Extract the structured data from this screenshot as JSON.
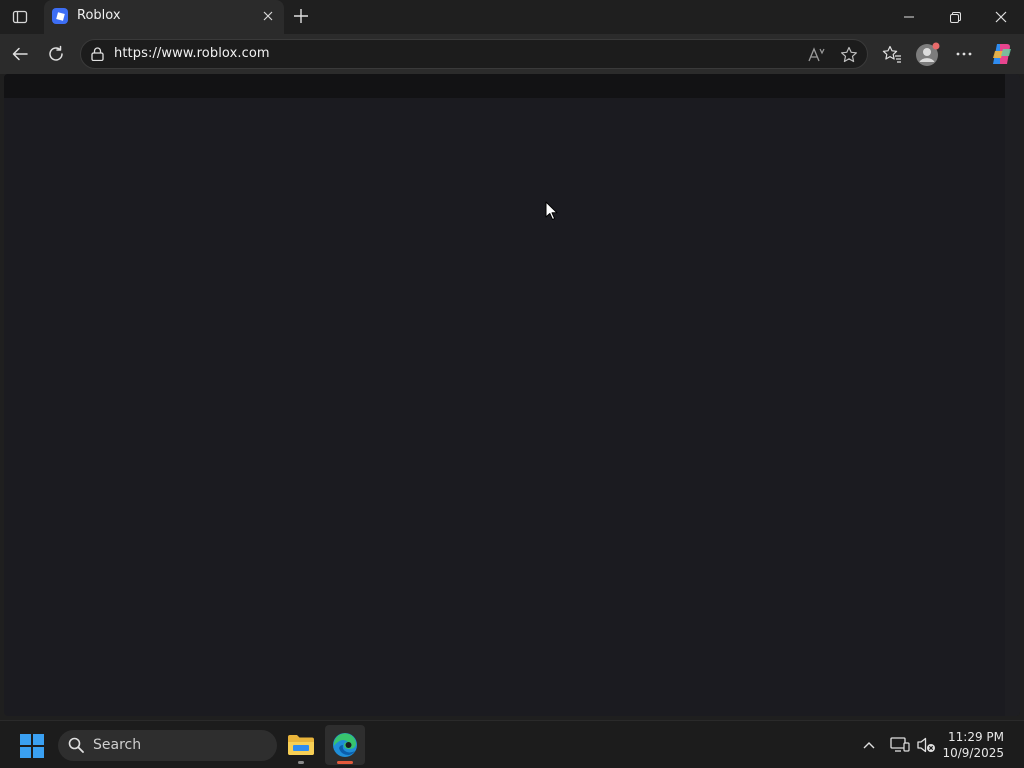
{
  "browser": {
    "tab": {
      "title": "Roblox"
    },
    "address": {
      "url": "https://www.roblox.com"
    }
  },
  "taskbar": {
    "search_label": "Search",
    "clock": {
      "time": "11:29 PM",
      "date": "10/9/2025"
    }
  },
  "colors": {
    "page_background": "#1b1b20",
    "chrome": "#2b2b2b",
    "roblox_favicon": "#3d6ef5",
    "edge_indicator": "#e35a3c"
  },
  "icons": {
    "tab_actions": "tab-actions-icon",
    "favicon": "roblox-favicon-icon",
    "close_tab": "close-icon",
    "new_tab": "plus-icon",
    "minimize": "minimize-icon",
    "restore": "restore-icon",
    "close_window": "close-icon",
    "back": "back-arrow-icon",
    "refresh": "refresh-icon",
    "lock": "lock-icon",
    "read_aloud": "read-aloud-icon",
    "favorite": "star-icon",
    "favorites": "favorites-icon",
    "profile": "profile-icon",
    "more": "more-icon",
    "copilot": "copilot-icon"
  }
}
